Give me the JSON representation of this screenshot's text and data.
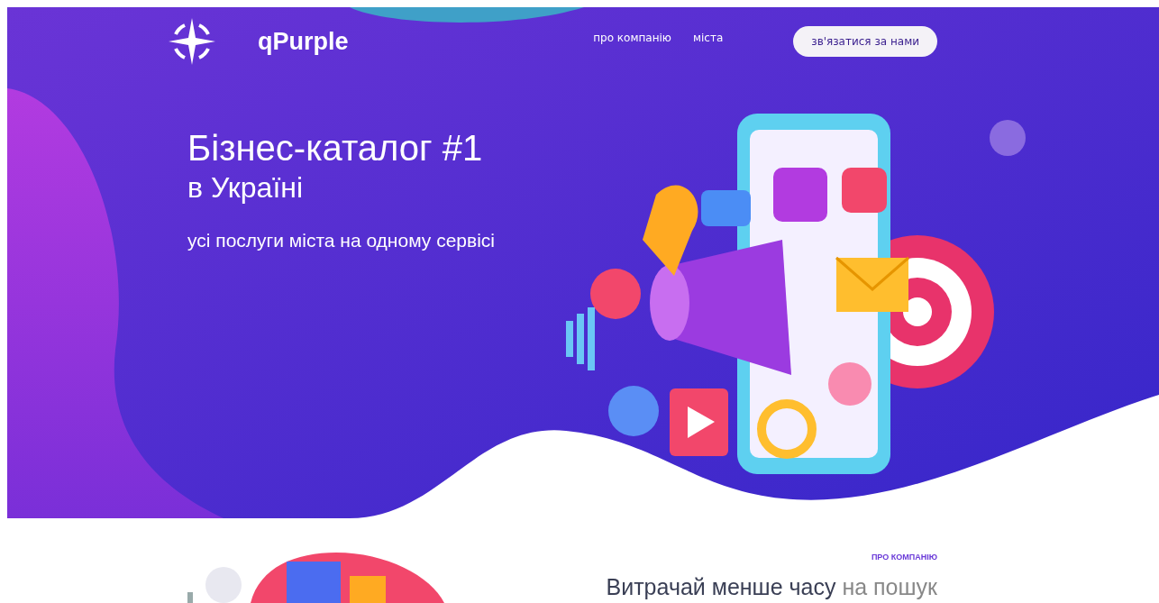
{
  "header": {
    "logo_text": "qPurple",
    "nav": [
      {
        "label": "про компанію"
      },
      {
        "label": "міста"
      }
    ],
    "cta": "зв'язатися за нами"
  },
  "hero": {
    "title": "Бізнес-каталог #1",
    "title_line2": "в Україні",
    "subtitle": "усі послуги міста на одному сервісі"
  },
  "about": {
    "eyebrow": "ПРО КОМПАНІЮ",
    "heading": "**Витрачай менше часу** на пошук"
  }
}
